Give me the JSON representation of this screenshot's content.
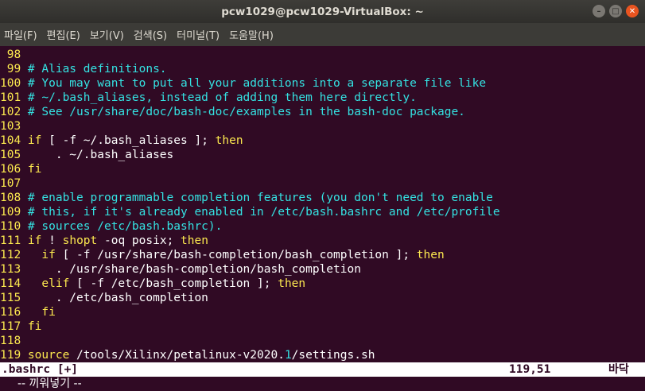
{
  "window": {
    "title": "pcw1029@pcw1029-VirtualBox: ~",
    "minimize_glyph": "–",
    "maximize_glyph": "□",
    "close_glyph": "✕"
  },
  "menu": [
    "파일(F)",
    "편집(E)",
    "보기(V)",
    "검색(S)",
    "터미널(T)",
    "도움말(H)"
  ],
  "lines": [
    {
      "n": " 98",
      "parts": []
    },
    {
      "n": " 99",
      "parts": [
        {
          "c": "cm",
          "t": " # Alias definitions."
        }
      ]
    },
    {
      "n": "100",
      "parts": [
        {
          "c": "cm",
          "t": " # You may want to put all your additions into a separate file like"
        }
      ]
    },
    {
      "n": "101",
      "parts": [
        {
          "c": "cm",
          "t": " # ~/.bash_aliases, instead of adding them here directly."
        }
      ]
    },
    {
      "n": "102",
      "parts": [
        {
          "c": "cm",
          "t": " # See /usr/share/doc/bash-doc/examples in the bash-doc package."
        }
      ]
    },
    {
      "n": "103",
      "parts": []
    },
    {
      "n": "104",
      "parts": [
        {
          "c": "kw",
          "t": " if"
        },
        {
          "c": "txt",
          "t": " [ -f ~/.bash_aliases ]; "
        },
        {
          "c": "kw",
          "t": "then"
        }
      ]
    },
    {
      "n": "105",
      "parts": [
        {
          "c": "txt",
          "t": "     . ~/.bash_aliases"
        }
      ]
    },
    {
      "n": "106",
      "parts": [
        {
          "c": "kw",
          "t": " fi"
        }
      ]
    },
    {
      "n": "107",
      "parts": []
    },
    {
      "n": "108",
      "parts": [
        {
          "c": "cm",
          "t": " # enable programmable completion features (you don't need to enable"
        }
      ]
    },
    {
      "n": "109",
      "parts": [
        {
          "c": "cm",
          "t": " # this, if it's already enabled in /etc/bash.bashrc and /etc/profile"
        }
      ]
    },
    {
      "n": "110",
      "parts": [
        {
          "c": "cm",
          "t": " # sources /etc/bash.bashrc)."
        }
      ]
    },
    {
      "n": "111",
      "parts": [
        {
          "c": "kw",
          "t": " if"
        },
        {
          "c": "txt",
          "t": " ! "
        },
        {
          "c": "kw",
          "t": "shopt"
        },
        {
          "c": "txt",
          "t": " -oq posix; "
        },
        {
          "c": "kw",
          "t": "then"
        }
      ]
    },
    {
      "n": "112",
      "parts": [
        {
          "c": "kw",
          "t": "   if"
        },
        {
          "c": "txt",
          "t": " [ -f /usr/share/bash-completion/bash_completion ]; "
        },
        {
          "c": "kw",
          "t": "then"
        }
      ]
    },
    {
      "n": "113",
      "parts": [
        {
          "c": "txt",
          "t": "     . /usr/share/bash-completion/bash_completion"
        }
      ]
    },
    {
      "n": "114",
      "parts": [
        {
          "c": "kw",
          "t": "   elif"
        },
        {
          "c": "txt",
          "t": " [ -f /etc/bash_completion ]; "
        },
        {
          "c": "kw",
          "t": "then"
        }
      ]
    },
    {
      "n": "115",
      "parts": [
        {
          "c": "txt",
          "t": "     . /etc/bash_completion"
        }
      ]
    },
    {
      "n": "116",
      "parts": [
        {
          "c": "kw",
          "t": "   fi"
        }
      ]
    },
    {
      "n": "117",
      "parts": [
        {
          "c": "kw",
          "t": " fi"
        }
      ]
    },
    {
      "n": "118",
      "parts": []
    },
    {
      "n": "119",
      "parts": [
        {
          "c": "kw",
          "t": " source"
        },
        {
          "c": "txt",
          "t": " /tools/Xilinx/petalinux-v2020."
        },
        {
          "c": "cm",
          "t": "1"
        },
        {
          "c": "txt",
          "t": "/settings.sh"
        }
      ]
    }
  ],
  "status": {
    "file": ".bashrc [+]",
    "position": "119,51",
    "scroll": "바닥"
  },
  "cmdline": "-- 끼워넣기 --",
  "colors": {
    "background": "#300a24",
    "line_number": "#fce94f",
    "comment": "#34e2e2",
    "keyword": "#fce94f",
    "text": "#ffffff"
  }
}
